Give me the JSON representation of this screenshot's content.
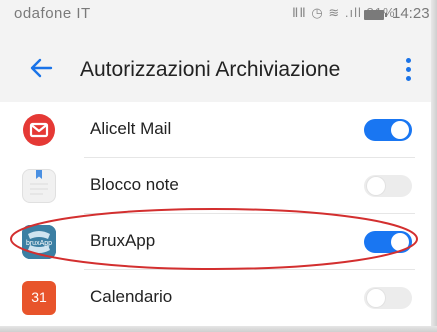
{
  "status_bar": {
    "carrier": "odafone IT",
    "signal_icons": "ⅡⅡ ◷ ≋ .ıll 81%",
    "battery_level_percent": 81,
    "time": "14:23"
  },
  "app_bar": {
    "title": "Autorizzazioni Archiviazione",
    "back_icon": "arrow-left",
    "menu_icon": "more-vertical",
    "accent_color": "#1a73e8"
  },
  "apps": [
    {
      "name": "Alicelt Mail",
      "enabled": true,
      "icon": "mail-envelope"
    },
    {
      "name": "Blocco note",
      "enabled": false,
      "icon": "notepad"
    },
    {
      "name": "BruxApp",
      "enabled": true,
      "icon": "brux-app",
      "icon_label": "bruxApp"
    },
    {
      "name": "Calendario",
      "enabled": false,
      "icon": "calendar",
      "icon_label": "31"
    }
  ],
  "colors": {
    "toggle_on": "#1976f2",
    "toggle_off": "#ececec",
    "highlight": "#d32f2f"
  }
}
